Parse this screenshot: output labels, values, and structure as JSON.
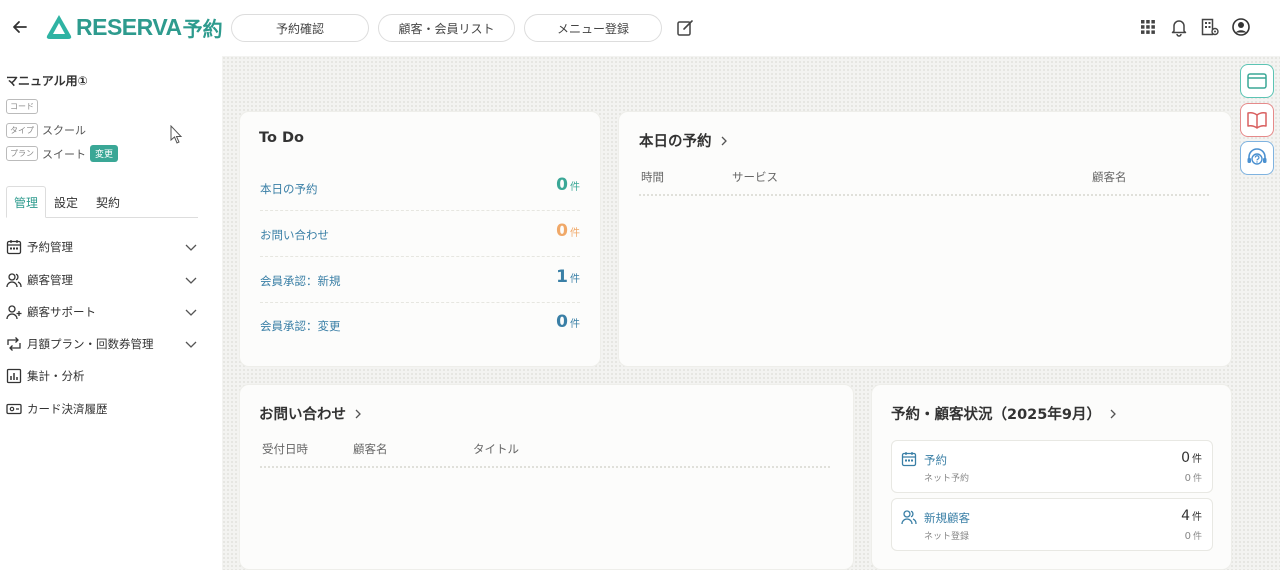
{
  "header": {
    "logo_text": "RESERVA",
    "logo_sub": "予約",
    "nav_buttons": [
      "予約確認",
      "顧客・会員リスト",
      "メニュー登録"
    ]
  },
  "sidebar": {
    "store_name": "マニュアル用①",
    "code_tag": "コード",
    "type_tag": "タイプ",
    "type_value": "スクール",
    "plan_tag": "プラン",
    "plan_value": "スイート",
    "change_badge": "変更",
    "tabs": [
      "管理",
      "設定",
      "契約"
    ],
    "items": [
      {
        "label": "予約管理",
        "icon": "calendar-icon"
      },
      {
        "label": "顧客管理",
        "icon": "users-icon"
      },
      {
        "label": "顧客サポート",
        "icon": "user-support-icon"
      },
      {
        "label": "月額プラン・回数券管理",
        "icon": "repeat-icon"
      },
      {
        "label": "集計・分析",
        "icon": "bar-chart-icon"
      },
      {
        "label": "カード決済履歴",
        "icon": "card-icon"
      }
    ]
  },
  "todo": {
    "title": "To Do",
    "rows": [
      {
        "label": "本日の予約",
        "value": "0",
        "unit": "件",
        "color": "#3aa796"
      },
      {
        "label": "お問い合わせ",
        "value": "0",
        "unit": "件",
        "color": "#f0a868"
      },
      {
        "label": "会員承認：新規",
        "value": "1",
        "unit": "件",
        "color": "#3a7fa6"
      },
      {
        "label": "会員承認：変更",
        "value": "0",
        "unit": "件",
        "color": "#3a7fa6"
      }
    ]
  },
  "today": {
    "title": "本日の予約",
    "columns": [
      "時間",
      "サービス",
      "顧客名"
    ]
  },
  "inquiry": {
    "title": "お問い合わせ",
    "columns": [
      "受付日時",
      "顧客名",
      "タイトル"
    ]
  },
  "status": {
    "title": "予約・顧客状況（2025年9月）",
    "items": [
      {
        "label": "予約",
        "sub": "ネット予約",
        "value": "0",
        "unit": "件",
        "sub_value": "0",
        "sub_unit": "件"
      },
      {
        "label": "新規顧客",
        "sub": "ネット登録",
        "value": "4",
        "unit": "件",
        "sub_value": "0",
        "sub_unit": "件"
      }
    ]
  },
  "colors": {
    "accent": "#2e9b8e",
    "link": "#3a7fa6",
    "orange": "#f0a868"
  }
}
